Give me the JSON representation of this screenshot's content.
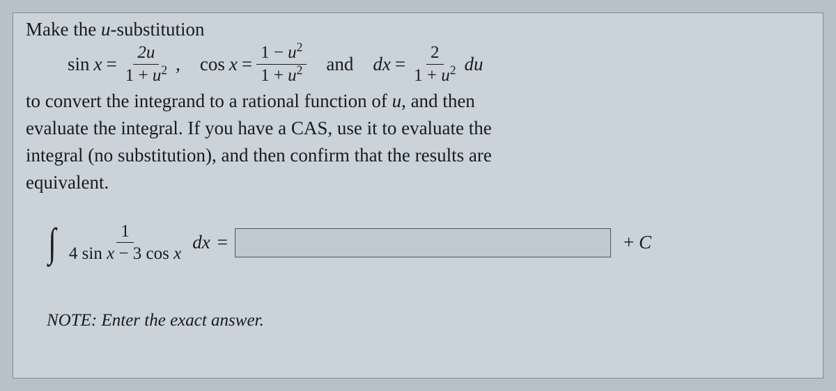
{
  "intro": "Make the ",
  "intro_var": "u",
  "intro_tail": "-substitution",
  "subst": {
    "sin_lhs": "sin",
    "x_var": "x",
    "eq": "=",
    "sin_num": "2u",
    "sin_den_pre": "1 + ",
    "sin_den_var": "u",
    "sin_den_exp": "2",
    "comma": ",",
    "cos_lhs": "cos",
    "cos_num_pre": "1 − ",
    "cos_num_var": "u",
    "cos_num_exp": "2",
    "cos_den_pre": "1 + ",
    "cos_den_var": "u",
    "cos_den_exp": "2",
    "and": "and",
    "dx_lhs": "dx",
    "dx_num": "2",
    "dx_den_pre": "1 + ",
    "dx_den_var": "u",
    "dx_den_exp": "2",
    "du": "du"
  },
  "body": {
    "line1_a": "to convert the integrand to a rational function of ",
    "line1_var": "u",
    "line1_b": ", and then",
    "line2": "evaluate the integral. If you have a CAS, use it to evaluate the",
    "line3": "integral (no substitution), and then confirm that the results are",
    "line4": "equivalent."
  },
  "integral": {
    "num": "1",
    "den_a": "4 sin ",
    "den_xvar1": "x",
    "den_b": " − 3 cos ",
    "den_xvar2": "x",
    "dx": "dx",
    "eq": "=",
    "answer_value": "",
    "plus_c": "+ C"
  },
  "note": {
    "label": "NOTE:",
    "text": " Enter the exact answer."
  }
}
